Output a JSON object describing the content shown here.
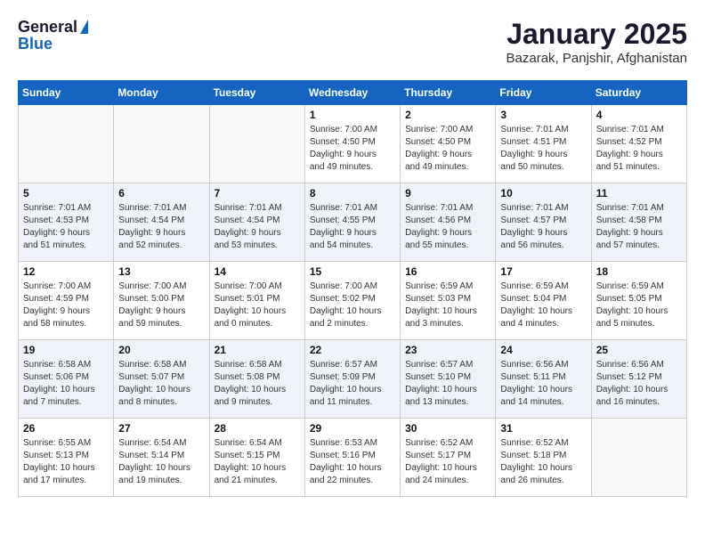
{
  "header": {
    "logo_general": "General",
    "logo_blue": "Blue",
    "title": "January 2025",
    "subtitle": "Bazarak, Panjshir, Afghanistan"
  },
  "weekdays": [
    "Sunday",
    "Monday",
    "Tuesday",
    "Wednesday",
    "Thursday",
    "Friday",
    "Saturday"
  ],
  "weeks": [
    [
      {
        "day": "",
        "info": ""
      },
      {
        "day": "",
        "info": ""
      },
      {
        "day": "",
        "info": ""
      },
      {
        "day": "1",
        "info": "Sunrise: 7:00 AM\nSunset: 4:50 PM\nDaylight: 9 hours\nand 49 minutes."
      },
      {
        "day": "2",
        "info": "Sunrise: 7:00 AM\nSunset: 4:50 PM\nDaylight: 9 hours\nand 49 minutes."
      },
      {
        "day": "3",
        "info": "Sunrise: 7:01 AM\nSunset: 4:51 PM\nDaylight: 9 hours\nand 50 minutes."
      },
      {
        "day": "4",
        "info": "Sunrise: 7:01 AM\nSunset: 4:52 PM\nDaylight: 9 hours\nand 51 minutes."
      }
    ],
    [
      {
        "day": "5",
        "info": "Sunrise: 7:01 AM\nSunset: 4:53 PM\nDaylight: 9 hours\nand 51 minutes."
      },
      {
        "day": "6",
        "info": "Sunrise: 7:01 AM\nSunset: 4:54 PM\nDaylight: 9 hours\nand 52 minutes."
      },
      {
        "day": "7",
        "info": "Sunrise: 7:01 AM\nSunset: 4:54 PM\nDaylight: 9 hours\nand 53 minutes."
      },
      {
        "day": "8",
        "info": "Sunrise: 7:01 AM\nSunset: 4:55 PM\nDaylight: 9 hours\nand 54 minutes."
      },
      {
        "day": "9",
        "info": "Sunrise: 7:01 AM\nSunset: 4:56 PM\nDaylight: 9 hours\nand 55 minutes."
      },
      {
        "day": "10",
        "info": "Sunrise: 7:01 AM\nSunset: 4:57 PM\nDaylight: 9 hours\nand 56 minutes."
      },
      {
        "day": "11",
        "info": "Sunrise: 7:01 AM\nSunset: 4:58 PM\nDaylight: 9 hours\nand 57 minutes."
      }
    ],
    [
      {
        "day": "12",
        "info": "Sunrise: 7:00 AM\nSunset: 4:59 PM\nDaylight: 9 hours\nand 58 minutes."
      },
      {
        "day": "13",
        "info": "Sunrise: 7:00 AM\nSunset: 5:00 PM\nDaylight: 9 hours\nand 59 minutes."
      },
      {
        "day": "14",
        "info": "Sunrise: 7:00 AM\nSunset: 5:01 PM\nDaylight: 10 hours\nand 0 minutes."
      },
      {
        "day": "15",
        "info": "Sunrise: 7:00 AM\nSunset: 5:02 PM\nDaylight: 10 hours\nand 2 minutes."
      },
      {
        "day": "16",
        "info": "Sunrise: 6:59 AM\nSunset: 5:03 PM\nDaylight: 10 hours\nand 3 minutes."
      },
      {
        "day": "17",
        "info": "Sunrise: 6:59 AM\nSunset: 5:04 PM\nDaylight: 10 hours\nand 4 minutes."
      },
      {
        "day": "18",
        "info": "Sunrise: 6:59 AM\nSunset: 5:05 PM\nDaylight: 10 hours\nand 5 minutes."
      }
    ],
    [
      {
        "day": "19",
        "info": "Sunrise: 6:58 AM\nSunset: 5:06 PM\nDaylight: 10 hours\nand 7 minutes."
      },
      {
        "day": "20",
        "info": "Sunrise: 6:58 AM\nSunset: 5:07 PM\nDaylight: 10 hours\nand 8 minutes."
      },
      {
        "day": "21",
        "info": "Sunrise: 6:58 AM\nSunset: 5:08 PM\nDaylight: 10 hours\nand 9 minutes."
      },
      {
        "day": "22",
        "info": "Sunrise: 6:57 AM\nSunset: 5:09 PM\nDaylight: 10 hours\nand 11 minutes."
      },
      {
        "day": "23",
        "info": "Sunrise: 6:57 AM\nSunset: 5:10 PM\nDaylight: 10 hours\nand 13 minutes."
      },
      {
        "day": "24",
        "info": "Sunrise: 6:56 AM\nSunset: 5:11 PM\nDaylight: 10 hours\nand 14 minutes."
      },
      {
        "day": "25",
        "info": "Sunrise: 6:56 AM\nSunset: 5:12 PM\nDaylight: 10 hours\nand 16 minutes."
      }
    ],
    [
      {
        "day": "26",
        "info": "Sunrise: 6:55 AM\nSunset: 5:13 PM\nDaylight: 10 hours\nand 17 minutes."
      },
      {
        "day": "27",
        "info": "Sunrise: 6:54 AM\nSunset: 5:14 PM\nDaylight: 10 hours\nand 19 minutes."
      },
      {
        "day": "28",
        "info": "Sunrise: 6:54 AM\nSunset: 5:15 PM\nDaylight: 10 hours\nand 21 minutes."
      },
      {
        "day": "29",
        "info": "Sunrise: 6:53 AM\nSunset: 5:16 PM\nDaylight: 10 hours\nand 22 minutes."
      },
      {
        "day": "30",
        "info": "Sunrise: 6:52 AM\nSunset: 5:17 PM\nDaylight: 10 hours\nand 24 minutes."
      },
      {
        "day": "31",
        "info": "Sunrise: 6:52 AM\nSunset: 5:18 PM\nDaylight: 10 hours\nand 26 minutes."
      },
      {
        "day": "",
        "info": ""
      }
    ]
  ]
}
